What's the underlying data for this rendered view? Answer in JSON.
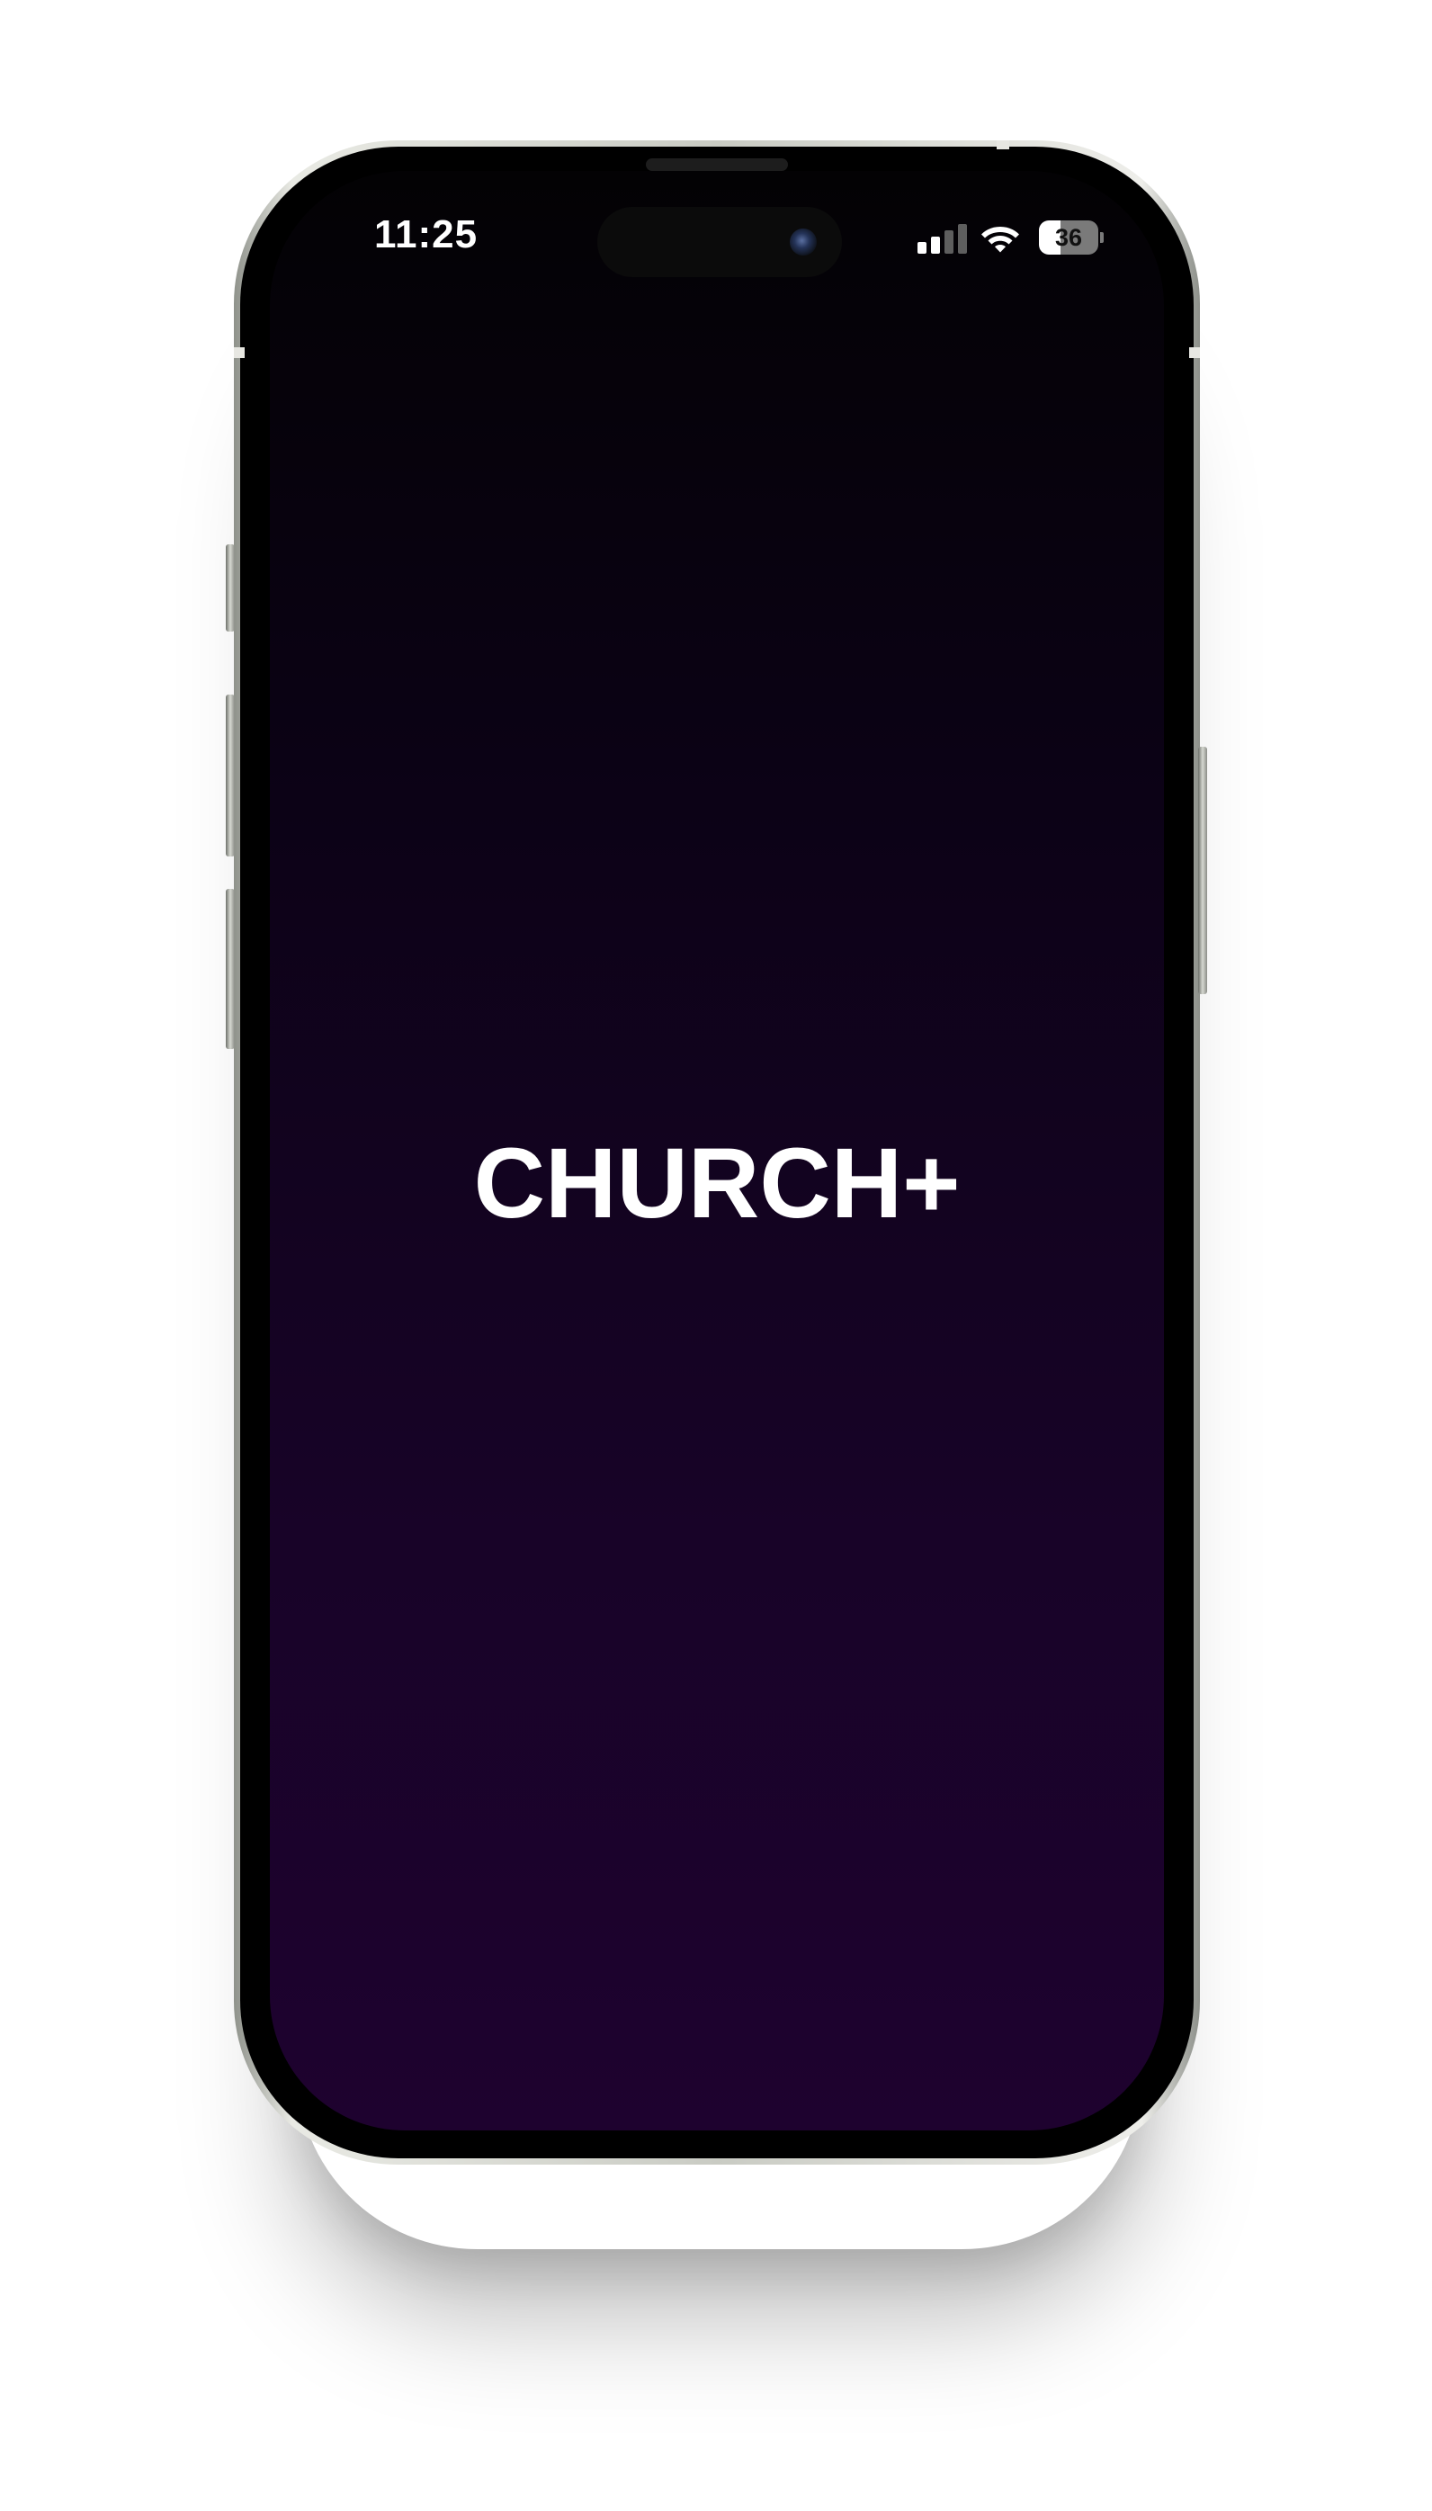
{
  "status_bar": {
    "time": "11:25",
    "battery_level": "36",
    "signal_icon": "cellular-signal-icon",
    "wifi_icon": "wifi-icon",
    "battery_icon": "battery-icon",
    "signal_bars_active": 2,
    "signal_bars_total": 4
  },
  "splash": {
    "logo_text": "CHURCH+"
  },
  "colors": {
    "background_top": "#030204",
    "background_bottom": "#1e022f",
    "logo_text": "#ffffff",
    "status_text": "#ffffff",
    "signal_active": "#ffffff",
    "signal_inactive": "#5e5e5e"
  }
}
